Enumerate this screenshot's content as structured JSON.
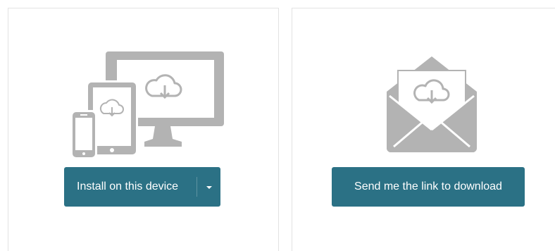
{
  "install_card": {
    "button_label": "Install on this device",
    "dropdown_icon": "caret-down-icon",
    "illustration_icon": "devices-cloud-download-icon"
  },
  "send_card": {
    "button_label": "Send me the link to download",
    "illustration_icon": "envelope-cloud-download-icon"
  },
  "colors": {
    "button_bg": "#2b7185",
    "button_text": "#ffffff",
    "illustration_gray": "#b3b3b3",
    "card_border": "#e2e2e2"
  }
}
